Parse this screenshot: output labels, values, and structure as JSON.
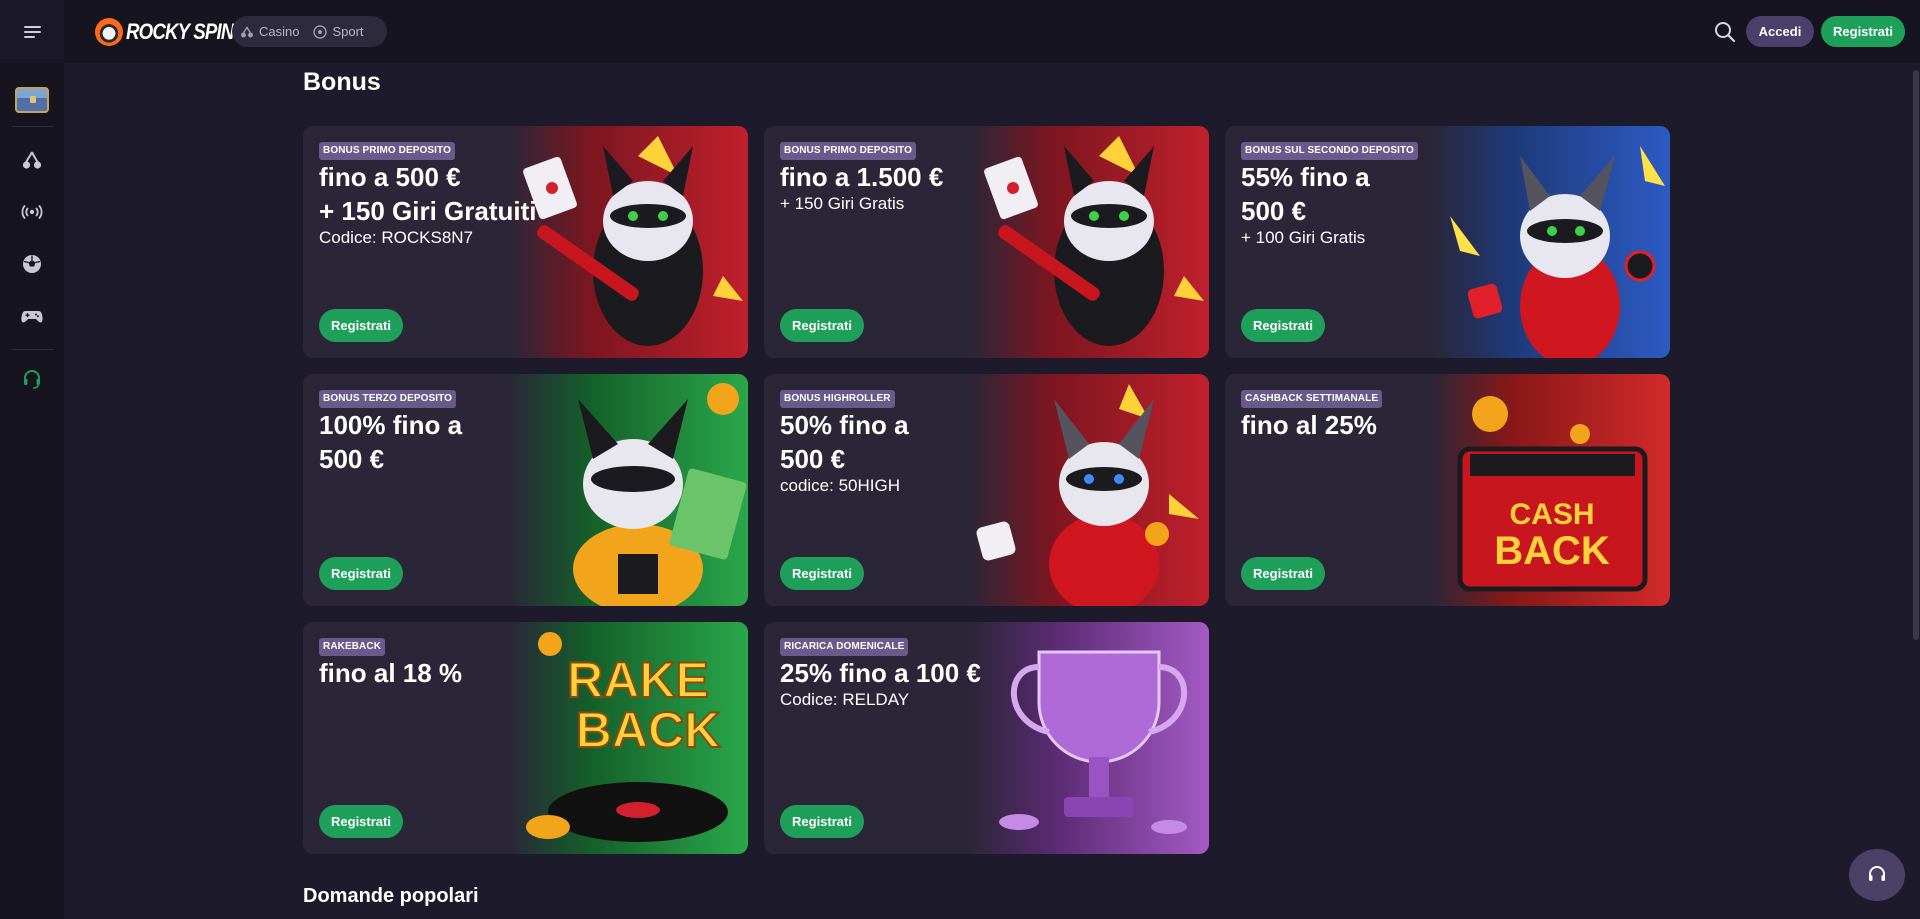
{
  "header": {
    "logo_text": "ROCKY SPIN",
    "nav": [
      {
        "label": "Casino",
        "icon": "cherry-icon"
      },
      {
        "label": "Sport",
        "icon": "soccer-ball-icon"
      }
    ],
    "login_label": "Accedi",
    "register_label": "Registrati"
  },
  "sidebar": {
    "items": [
      {
        "icon": "treasure-chest-icon"
      },
      {
        "icon": "cherry-icon"
      },
      {
        "icon": "live-broadcast-icon"
      },
      {
        "icon": "soccer-ball-icon"
      },
      {
        "icon": "gamepad-icon"
      },
      {
        "icon": "headset-support-icon"
      }
    ]
  },
  "main": {
    "title": "Bonus",
    "cards": [
      {
        "tag": "BONUS PRIMO DEPOSITO",
        "headline": [
          "fino a 500 €",
          "+ 150 Giri Gratuiti"
        ],
        "sub": "Codice: ROCKS8N7",
        "cta": "Registrati",
        "art": "raccoon-guitar",
        "colors": [
          "#7d1620",
          "#c0202c"
        ]
      },
      {
        "tag": "BONUS PRIMO DEPOSITO",
        "headline": [
          "fino a 1.500 €"
        ],
        "sub": "+ 150 Giri Gratis",
        "cta": "Registrati",
        "art": "raccoon-guitar",
        "colors": [
          "#7d1620",
          "#c0202c"
        ]
      },
      {
        "tag": "BONUS SUL SECONDO DEPOSITO",
        "headline": [
          "55% fino a",
          "500 €"
        ],
        "sub": "+ 100 Giri Gratis",
        "cta": "Registrati",
        "art": "raccoon-jacket",
        "colors": [
          "#1e3a7a",
          "#2d5bc4"
        ]
      },
      {
        "tag": "BONUS TERZO DEPOSITO",
        "headline": [
          "100% fino a",
          "500 €"
        ],
        "sub": "",
        "cta": "Registrati",
        "art": "raccoon-cash",
        "colors": [
          "#14612a",
          "#2aa84a"
        ]
      },
      {
        "tag": "BONUS HIGHROLLER",
        "headline": [
          "50% fino a",
          "500 €"
        ],
        "sub": "codice: 50HIGH",
        "cta": "Registrati",
        "art": "raccoon-dice",
        "colors": [
          "#7d1620",
          "#c0202c"
        ]
      },
      {
        "tag": "CASHBACK SETTIMANALE",
        "headline": [
          "fino al 25%"
        ],
        "sub": "",
        "cta": "Registrati",
        "art": "cash-back-amp",
        "colors": [
          "#8a1818",
          "#d22a2a"
        ]
      },
      {
        "tag": "RAKEBACK",
        "headline": [
          "fino al 18 %"
        ],
        "sub": "",
        "cta": "Registrati",
        "art": "rake-back-vinyl",
        "colors": [
          "#14612a",
          "#2aa84a"
        ]
      },
      {
        "tag": "RICARICA DOMENICALE",
        "headline": [
          "25% fino a 100 €"
        ],
        "sub": "Codice: RELDAY",
        "cta": "Registrati",
        "art": "purple-trophy",
        "colors": [
          "#5a2a72",
          "#a45ac4"
        ]
      }
    ],
    "art_text": {
      "cash_back": [
        "CASH",
        "BACK"
      ],
      "rake_back": [
        "RAKE",
        "BACK"
      ]
    },
    "faq_title": "Domande popolari"
  },
  "colors": {
    "background": "#1c1a2b",
    "card": "#2a2637",
    "accent_green": "#1ea05a",
    "tag_purple": "#6a5a8c"
  }
}
